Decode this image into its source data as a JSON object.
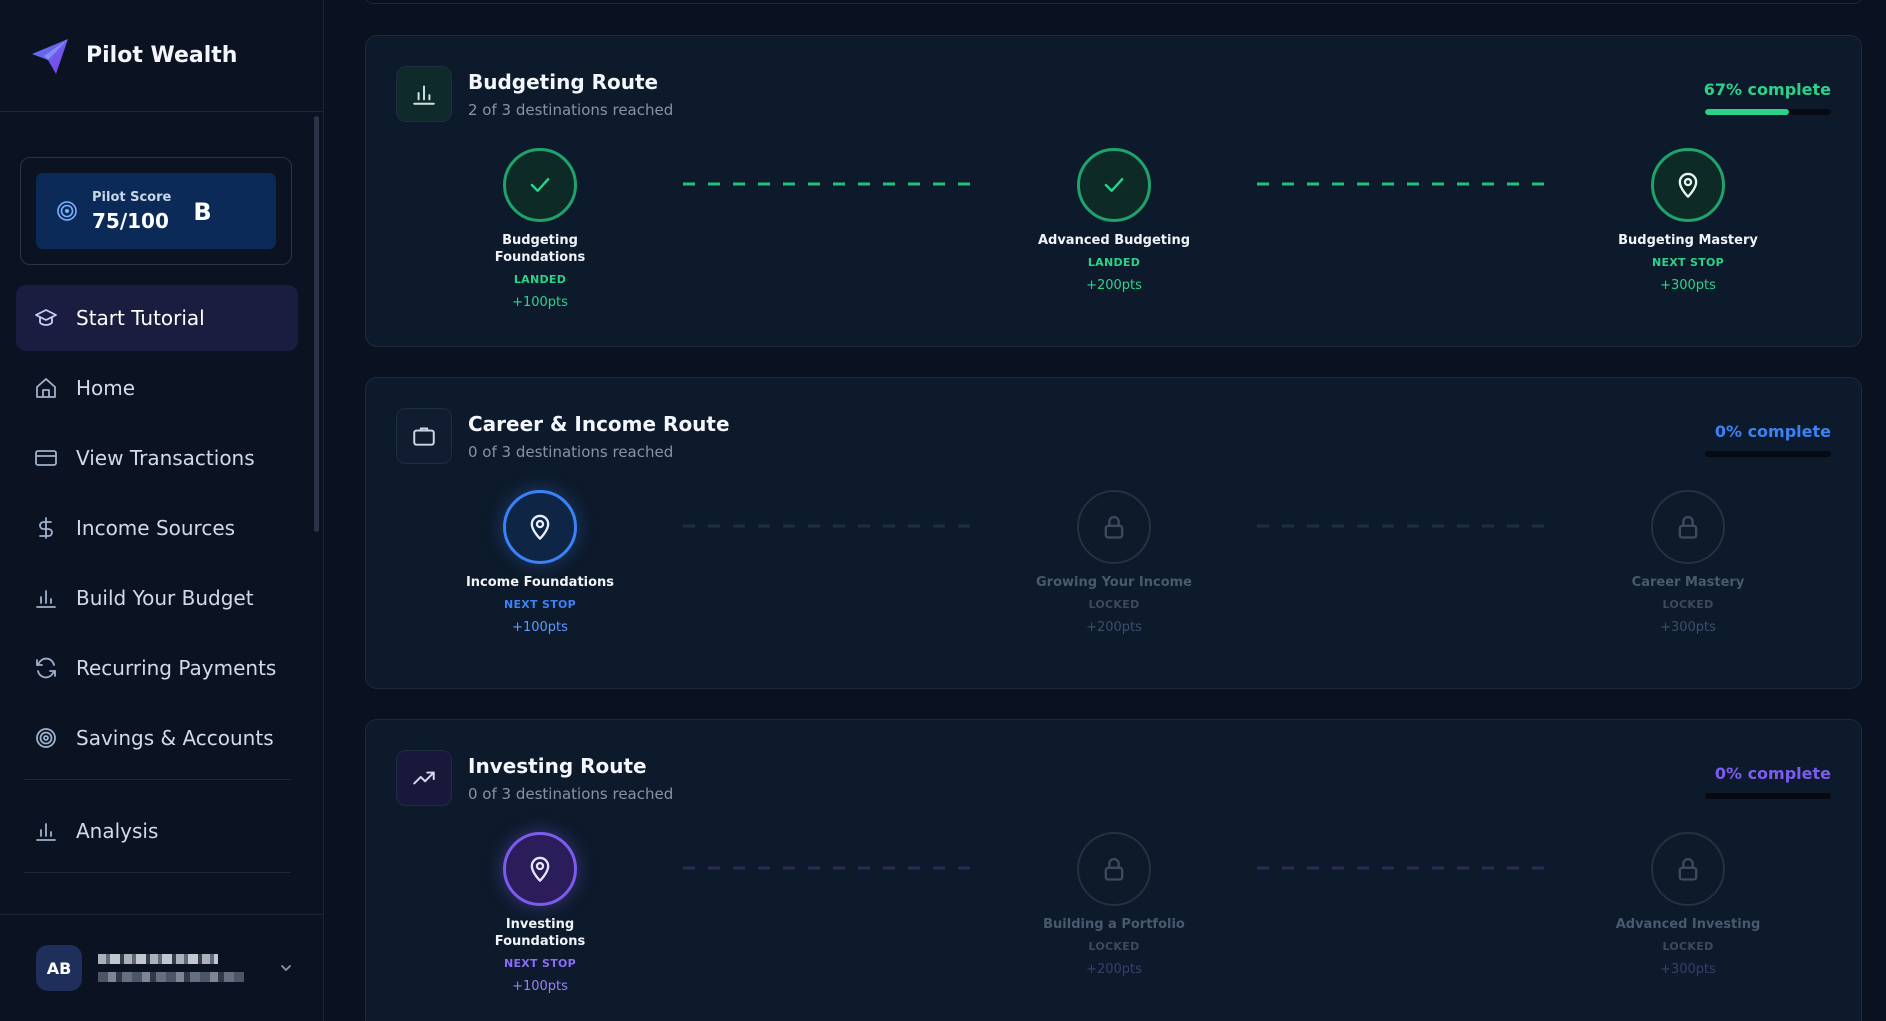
{
  "brand": {
    "name": "Pilot Wealth"
  },
  "score": {
    "label": "Pilot Score",
    "value": "75/100",
    "grade": "B"
  },
  "nav": {
    "items": [
      {
        "label": "Start Tutorial",
        "icon": "graduation-cap-icon",
        "active": true
      },
      {
        "label": "Home",
        "icon": "home-icon"
      },
      {
        "label": "View Transactions",
        "icon": "credit-card-icon"
      },
      {
        "label": "Income Sources",
        "icon": "dollar-icon"
      },
      {
        "label": "Build Your Budget",
        "icon": "bar-chart-icon"
      },
      {
        "label": "Recurring Payments",
        "icon": "refresh-icon"
      },
      {
        "label": "Savings & Accounts",
        "icon": "target-icon"
      },
      {
        "label": "Analysis",
        "icon": "bar-chart-icon"
      }
    ]
  },
  "user": {
    "initials": "AB"
  },
  "colors": {
    "green": "#2bd38a",
    "blue": "#3b82f6",
    "purple": "#7c5cf0",
    "locked_text": "#3d4a5e",
    "locked_points": "#3a4d6a"
  },
  "routes": [
    {
      "title": "Budgeting Route",
      "subtitle": "2 of 3 destinations reached",
      "progress_label": "67% complete",
      "progress": 0.67,
      "theme": "green",
      "stops": [
        {
          "name": "Budgeting Foundations",
          "status": "LANDED",
          "points": "+100pts"
        },
        {
          "name": "Advanced Budgeting",
          "status": "LANDED",
          "points": "+200pts"
        },
        {
          "name": "Budgeting Mastery",
          "status": "NEXT STOP",
          "points": "+300pts"
        }
      ]
    },
    {
      "title": "Career & Income Route",
      "subtitle": "0 of 3 destinations reached",
      "progress_label": "0% complete",
      "progress": 0,
      "theme": "blue",
      "stops": [
        {
          "name": "Income Foundations",
          "status": "NEXT STOP",
          "points": "+100pts"
        },
        {
          "name": "Growing Your Income",
          "status": "LOCKED",
          "points": "+200pts"
        },
        {
          "name": "Career Mastery",
          "status": "LOCKED",
          "points": "+300pts"
        }
      ]
    },
    {
      "title": "Investing Route",
      "subtitle": "0 of 3 destinations reached",
      "progress_label": "0% complete",
      "progress": 0,
      "theme": "purple",
      "stops": [
        {
          "name": "Investing Foundations",
          "status": "NEXT STOP",
          "points": "+100pts"
        },
        {
          "name": "Building a Portfolio",
          "status": "LOCKED",
          "points": "+200pts"
        },
        {
          "name": "Advanced Investing",
          "status": "LOCKED",
          "points": "+300pts"
        }
      ]
    }
  ]
}
